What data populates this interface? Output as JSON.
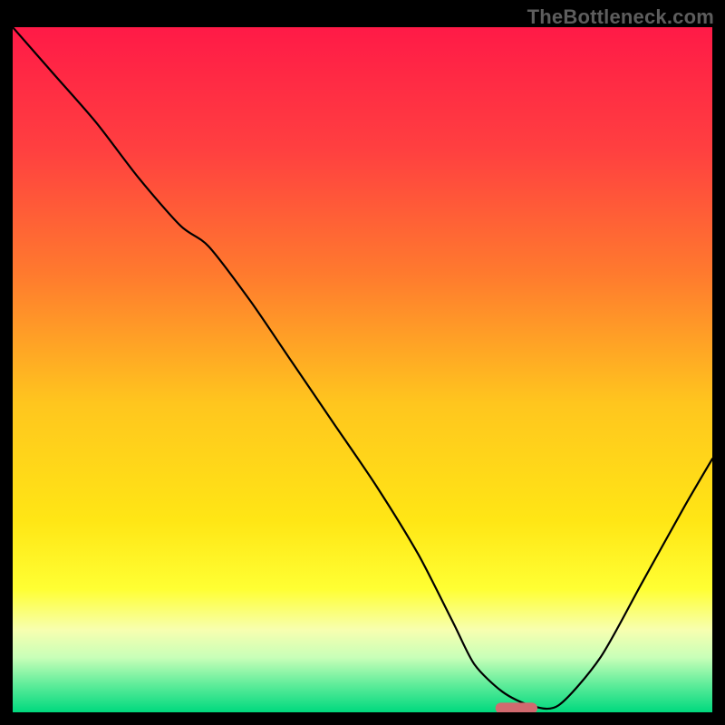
{
  "watermark": "TheBottleneck.com",
  "chart_data": {
    "type": "line",
    "title": "",
    "xlabel": "",
    "ylabel": "",
    "xlim": [
      0,
      100
    ],
    "ylim": [
      0,
      100
    ],
    "grid": false,
    "legend": false,
    "background_gradient": {
      "stops": [
        {
          "offset": 0.0,
          "color": "#ff1a47"
        },
        {
          "offset": 0.18,
          "color": "#ff4040"
        },
        {
          "offset": 0.36,
          "color": "#ff7a2e"
        },
        {
          "offset": 0.55,
          "color": "#ffc61e"
        },
        {
          "offset": 0.72,
          "color": "#ffe615"
        },
        {
          "offset": 0.82,
          "color": "#ffff33"
        },
        {
          "offset": 0.88,
          "color": "#f7ffb0"
        },
        {
          "offset": 0.92,
          "color": "#c8ffb8"
        },
        {
          "offset": 0.96,
          "color": "#5eec9a"
        },
        {
          "offset": 1.0,
          "color": "#00d97e"
        }
      ]
    },
    "series": [
      {
        "name": "bottleneck-curve",
        "color": "#000000",
        "x": [
          0,
          6,
          12,
          18,
          24,
          28,
          34,
          40,
          46,
          52,
          58,
          63,
          66,
          70,
          74,
          78,
          84,
          90,
          96,
          100
        ],
        "y": [
          100,
          93,
          86,
          78,
          71,
          68,
          60,
          51,
          42,
          33,
          23,
          13,
          7,
          3,
          1,
          1,
          8,
          19,
          30,
          37
        ]
      }
    ],
    "marker": {
      "name": "optimal-point",
      "x": 72,
      "y": 0.6,
      "width_pct": 6,
      "height_pct": 1.6,
      "color": "#d16a6f"
    }
  }
}
